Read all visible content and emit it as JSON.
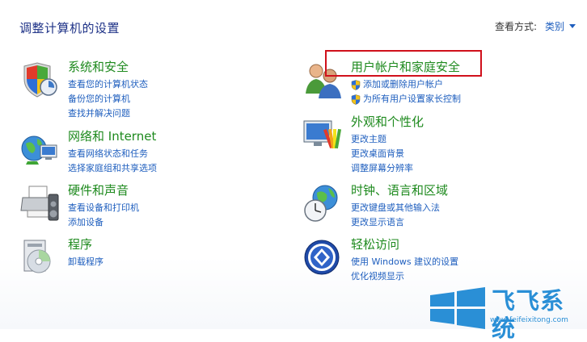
{
  "header": {
    "title": "调整计算机的设置",
    "view_by_label": "查看方式:",
    "view_by_value": "类别"
  },
  "left": [
    {
      "title": "系统和安全",
      "links": [
        "查看您的计算机状态",
        "备份您的计算机",
        "查找并解决问题"
      ]
    },
    {
      "title": "网络和 Internet",
      "links": [
        "查看网络状态和任务",
        "选择家庭组和共享选项"
      ]
    },
    {
      "title": "硬件和声音",
      "links": [
        "查看设备和打印机",
        "添加设备"
      ]
    },
    {
      "title": "程序",
      "links": [
        "卸载程序"
      ]
    }
  ],
  "right": [
    {
      "title": "用户帐户和家庭安全",
      "links": [
        "添加或删除用户帐户",
        "为所有用户设置家长控制"
      ]
    },
    {
      "title": "外观和个性化",
      "links": [
        "更改主题",
        "更改桌面背景",
        "调整屏幕分辨率"
      ]
    },
    {
      "title": "时钟、语言和区域",
      "links": [
        "更改键盘或其他输入法",
        "更改显示语言"
      ]
    },
    {
      "title": "轻松访问",
      "links": [
        "使用 Windows 建议的设置",
        "优化视频显示"
      ]
    }
  ],
  "watermark": {
    "brand": "飞飞系统",
    "url": "www.feifeixitong.com"
  },
  "colors": {
    "title_blue": "#1e3287",
    "category_green": "#1e8a1e",
    "link_blue": "#1e5ebe",
    "highlight_red": "#d0101b",
    "watermark_blue": "#2a8fd6"
  }
}
